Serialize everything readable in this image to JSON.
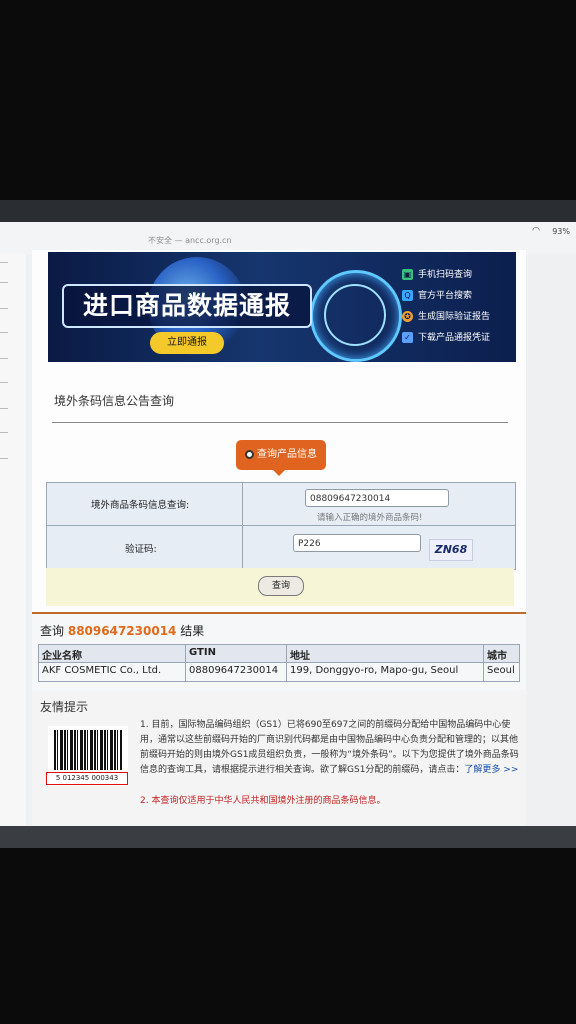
{
  "status_bar": {
    "url": "不安全 — ancc.org.cn",
    "wifi_icon": "wifi-icon",
    "battery": "93%"
  },
  "banner": {
    "title": "进口商品数据通报",
    "button": "立即通报",
    "menu": [
      {
        "icon": "phone-scan-icon",
        "label": "手机扫码查询",
        "color": "#36c27a"
      },
      {
        "icon": "search-icon",
        "label": "官方平台搜索",
        "color": "#3aa6ff"
      },
      {
        "icon": "badge-icon",
        "label": "生成国际验证报告",
        "color": "#f0a030"
      },
      {
        "icon": "shield-icon",
        "label": "下载产品通报凭证",
        "color": "#5aa0ff"
      }
    ]
  },
  "query_section": {
    "title": "境外条码信息公告查询",
    "tab_label": "查询产品信息",
    "barcode_label": "境外商品条码信息查询:",
    "barcode_value": "08809647230014",
    "barcode_hint": "请输入正确的境外商品条码!",
    "captcha_label": "验证码:",
    "captcha_value": "P226",
    "captcha_image_text": "ZN68",
    "submit": "查询"
  },
  "result": {
    "title_prefix": "查询",
    "query_number": "8809647230014",
    "title_suffix": "结果",
    "headers": [
      "企业名称",
      "GTIN",
      "地址",
      "城市"
    ],
    "row": [
      "AKF COSMETIC Co., Ltd.",
      "08809647230014",
      "199, Donggyo-ro, Mapo-gu, Seoul",
      "Seoul"
    ]
  },
  "tips": {
    "title": "友情提示",
    "barcode_sample": "5 012345 000343",
    "item1": "1. 目前，国际物品编码组织（GS1）已将690至697之间的前缀码分配给中国物品编码中心使用，通常以这些前缀码开始的厂商识别代码都是由中国物品编码中心负责分配和管理的；以其他前缀码开始的则由境外GS1成员组织负责，一般称为“境外条码”。以下为您提供了境外商品条码信息的查询工具，请根据提示进行相关查询。欲了解GS1分配的前缀码，请点击：",
    "item1_link": "了解更多 >>",
    "item2": "2. 本查询仅适用于中华人民共和国境外注册的商品条码信息。"
  },
  "colors": {
    "accent": "#e0631f",
    "result_number": "#e06a1a",
    "banner_bg": "#0a1a44",
    "button_yellow": "#f4c92a"
  }
}
